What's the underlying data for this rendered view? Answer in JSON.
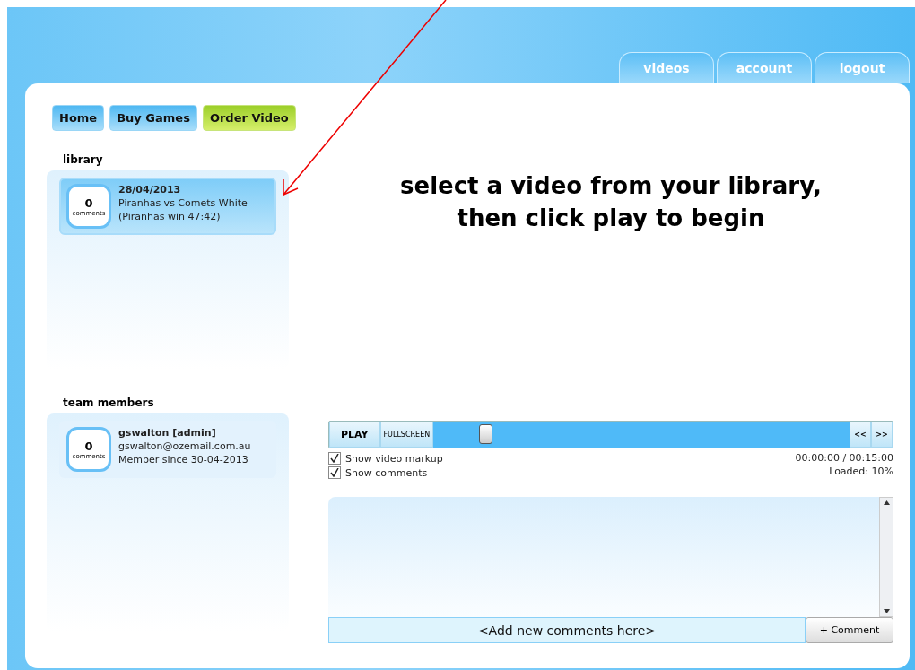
{
  "top_tabs": [
    {
      "label": "videos",
      "selected": false
    },
    {
      "label": "account",
      "selected": false
    },
    {
      "label": "logout",
      "selected": false
    }
  ],
  "nav_buttons": [
    {
      "label": "Home",
      "selected": false
    },
    {
      "label": "Buy Games",
      "selected": false
    },
    {
      "label": "Order Video",
      "selected": true
    }
  ],
  "library": {
    "title": "library",
    "items": [
      {
        "count": "0",
        "count_label": "comments",
        "date": "28/04/2013",
        "title": "Piranhas vs Comets White",
        "result": "(Piranhas win 47:42)",
        "selected": true
      }
    ]
  },
  "team_members": {
    "title": "team members",
    "items": [
      {
        "count": "0",
        "count_label": "comments",
        "name": "gswalton [admin]",
        "email": "gswalton@ozemail.com.au",
        "since": "Member since 30-04-2013"
      }
    ]
  },
  "message": "select a video from your library, then click play to begin",
  "player": {
    "play": "PLAY",
    "fullscreen": "FULLSCREEN",
    "seek": {
      "level": 0.11
    },
    "rewind": "<<",
    "forward": ">>",
    "time": "00:00:00 / 00:15:00",
    "loaded": "Loaded: 10%",
    "options": [
      {
        "label": "Show video markup",
        "checked": true
      },
      {
        "label": "Show comments",
        "checked": true
      }
    ]
  },
  "comments": {
    "placeholder": "<Add new comments here>",
    "button": "+ Comment"
  }
}
